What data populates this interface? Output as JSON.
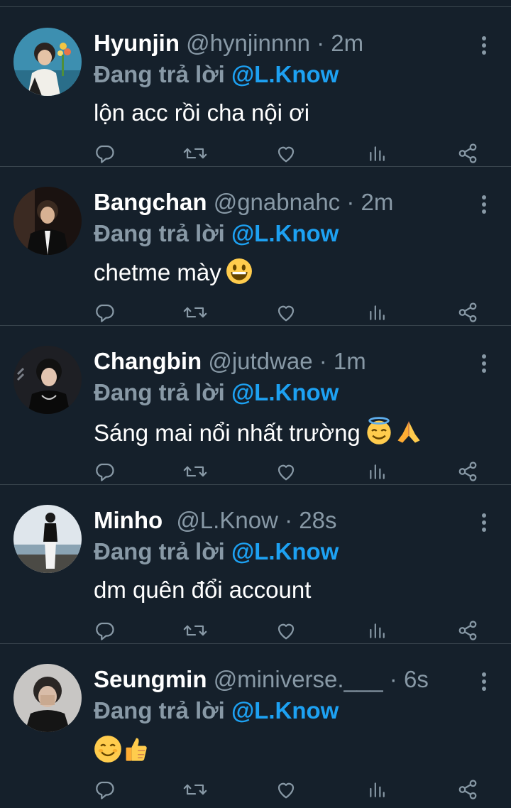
{
  "reply_prefix": "Đang trả lời",
  "colors": {
    "background": "#15202b",
    "divider": "#38444d",
    "secondary_text": "#8899a6",
    "accent": "#1da1f2"
  },
  "icons": {
    "reply": "reply-icon",
    "retweet": "retweet-icon",
    "like": "heart-icon",
    "stats": "analytics-icon",
    "share": "share-icon",
    "more": "more-vertical-icon"
  },
  "tweets": [
    {
      "name": "Hyunjin",
      "handle": "@hynjinnnn",
      "sep": "·",
      "time": "2m",
      "reply_to": "@L.Know",
      "text": "lộn acc rồi cha nội ơi",
      "emoji": []
    },
    {
      "name": "Bangchan",
      "handle": "@gnabnahc",
      "sep": "·",
      "time": "2m",
      "reply_to": "@L.Know",
      "text": "chetme mày",
      "emoji": [
        "grinning-face-emoji"
      ]
    },
    {
      "name": "Changbin",
      "handle": "@jutdwae",
      "sep": "·",
      "time": "1m",
      "reply_to": "@L.Know",
      "text": "Sáng mai nổi nhất trường",
      "emoji": [
        "halo-face-emoji",
        "folded-hands-emoji"
      ]
    },
    {
      "name": "Minho",
      "handle": "@L.Know",
      "sep": "·",
      "time": "28s",
      "reply_to": "@L.Know",
      "text": "dm quên đổi account",
      "emoji": []
    },
    {
      "name": "Seungmin",
      "handle": "@miniverse.___",
      "sep": "·",
      "time": "6s",
      "reply_to": "@L.Know",
      "text": "",
      "emoji": [
        "smiling-face-emoji",
        "thumbs-up-emoji"
      ]
    }
  ]
}
